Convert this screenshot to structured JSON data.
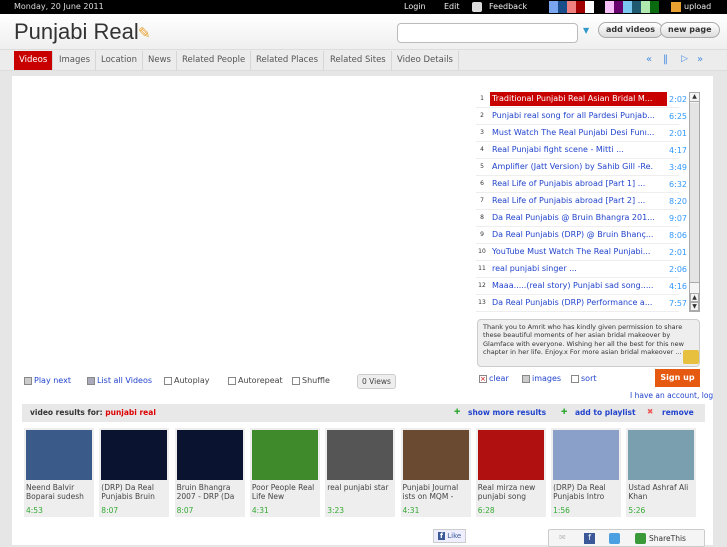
{
  "topbar": {
    "date": "Monday, 20 June 2011",
    "login": "Login",
    "edit": "Edit",
    "feedback": "Feedback",
    "upload": "upload",
    "swatches": [
      "#7aa6f0",
      "#1a4e8a",
      "#f08080",
      "#a00000",
      "#ffffff",
      "#000000",
      "#f8c0f8",
      "#6a0070",
      "#7ac8f0",
      "#205a70",
      "#b0e8b0",
      "#0a6a10"
    ]
  },
  "header": {
    "title": "Punjabi Real",
    "search_value": "",
    "add_videos": "add videos",
    "new_page": "new page"
  },
  "tabs": [
    "Videos",
    "Images",
    "Location",
    "News",
    "Related People",
    "Related Places",
    "Related Sites",
    "Video Details"
  ],
  "playlist": [
    {
      "n": "1",
      "title": "Traditional Punjabi Real Asian Bridal M...",
      "dur": "2:02"
    },
    {
      "n": "2",
      "title": "Punjabi real song for all Pardesi Punjab...",
      "dur": "6:25"
    },
    {
      "n": "3",
      "title": "Must Watch The Real Punjabi Desi Funı...",
      "dur": "2:01"
    },
    {
      "n": "4",
      "title": "Real Punjabi fight scene - Mitti          ...",
      "dur": "4:17"
    },
    {
      "n": "5",
      "title": "Amplifier (Jatt Version) by Sahib Gill -Re...",
      "dur": "3:49"
    },
    {
      "n": "6",
      "title": "Real Life of Punjabis abroad [Part 1]     ...",
      "dur": "6:32"
    },
    {
      "n": "7",
      "title": "Real Life of Punjabis abroad [Part 2]     ...",
      "dur": "8:20"
    },
    {
      "n": "8",
      "title": "Da Real Punjabis @ Bruin Bhangra 201...",
      "dur": "9:07"
    },
    {
      "n": "9",
      "title": "Da Real Punjabis (DRP) @ Bruin Bhanç...",
      "dur": "8:06"
    },
    {
      "n": "10",
      "title": "YouTube Must Watch The Real Punjabi...",
      "dur": "2:01"
    },
    {
      "n": "11",
      "title": "real punjabi singer                              ...",
      "dur": "2:06"
    },
    {
      "n": "12",
      "title": "Maaa.....(real story) Punjabi sad song.......",
      "dur": "4:16"
    },
    {
      "n": "13",
      "title": "Da Real Punjabis (DRP) Performance a...",
      "dur": "7:57"
    }
  ],
  "description": "Thank you to Amrit who has kindly given permission to share these beautiful moments of her asian bridal makeover by Glamface with everyone. Wishing her all the best for this new chapter in her life. Enjoy.x For more asian bridal makeover ...",
  "controls": {
    "play_next": "Play next",
    "list_all": "List all Videos",
    "autoplay": "Autoplay",
    "autorepeat": "Autorepeat",
    "shuffle": "Shuffle",
    "views": "0 Views",
    "clear": "clear",
    "images": "images",
    "sort": "sort",
    "signup": "Sign up",
    "account": "I have an account, log"
  },
  "results": {
    "label": "video results for:",
    "query": "punjabi real",
    "show_more": "show more results",
    "add_playlist": "add to playlist",
    "remove": "remove"
  },
  "thumbs": [
    {
      "title": "Neend Balvir Boparai sudesh",
      "dur": "4:53",
      "color": "#3a5a8a"
    },
    {
      "title": "(DRP) Da Real Punjabis Bruin",
      "dur": "8:07",
      "color": "#0a1430"
    },
    {
      "title": "Bruin Bhangra 2007 - DRP (Da",
      "dur": "8:07",
      "color": "#0a1430"
    },
    {
      "title": "Poor People Real Life New",
      "dur": "4:31",
      "color": "#3f8a2a"
    },
    {
      "title": "real punjabi star",
      "dur": "3:23",
      "color": "#555"
    },
    {
      "title": "Punjabi Journal ists on MQM -",
      "dur": "4:31",
      "color": "#6a4a30"
    },
    {
      "title": "Real mirza new punjabi song",
      "dur": "6:28",
      "color": "#b01010"
    },
    {
      "title": "(DRP) Da Real Punjabis Intro",
      "dur": "1:56",
      "color": "#8aa0c8"
    },
    {
      "title": "Ustad Ashraf Ali Khan",
      "dur": "5:26",
      "color": "#7aa0b0"
    }
  ],
  "footer": {
    "like": "Like",
    "share": "ShareThis"
  }
}
